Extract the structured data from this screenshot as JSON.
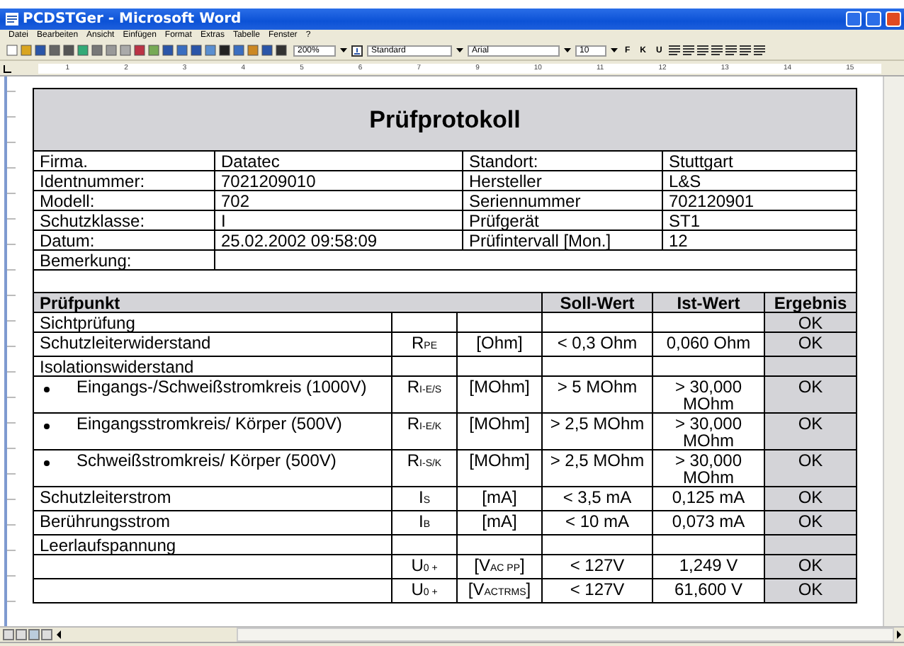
{
  "window": {
    "title": "PCDSTGer - Microsoft Word"
  },
  "menu": [
    "Datei",
    "Bearbeiten",
    "Ansicht",
    "Einfügen",
    "Format",
    "Extras",
    "Tabelle",
    "Fenster",
    "?"
  ],
  "toolbar": {
    "zoom": "200%",
    "style": "Standard",
    "font": "Arial",
    "font_size": "10",
    "format_buttons": [
      "F",
      "K",
      "U"
    ]
  },
  "ruler": {
    "ticks": [
      "1",
      "2",
      "3",
      "4",
      "5",
      "6",
      "7",
      "9",
      "10",
      "11",
      "12",
      "13",
      "14",
      "15"
    ]
  },
  "document": {
    "title": "Prüfprotokoll",
    "info_rows": [
      [
        "Firma.",
        "Datatec",
        "Standort:",
        "Stuttgart"
      ],
      [
        "Identnummer:",
        "7021209010",
        "Hersteller",
        "L&S"
      ],
      [
        "Modell:",
        "702",
        "Seriennummer",
        "702120901"
      ],
      [
        "Schutzklasse:",
        "I",
        "Prüfgerät",
        "ST1"
      ],
      [
        "Datum:",
        "25.02.2002 09:58:09",
        "Prüfintervall [Mon.]",
        "12"
      ]
    ],
    "remark_label": "Bemerkung:",
    "columns": [
      "Prüfpunkt",
      "Soll-Wert",
      "Ist-Wert",
      "Ergebnis"
    ],
    "rows": [
      {
        "kind": "plain",
        "test": "Sichtprüfung",
        "result": "OK"
      },
      {
        "kind": "plain",
        "test": "Schutzleiterwiderstand",
        "symbol": "R$_{PE}$",
        "unit": "[Ohm]",
        "target": "< 0,3 Ohm",
        "actual": "0,060 Ohm",
        "result": "OK"
      },
      {
        "kind": "plain",
        "test": "Isolationswiderstand"
      },
      {
        "kind": "bullet",
        "test": "Eingangs-/Schweißstromkreis (1000V)",
        "symbol": "R$_{I-E/S}$",
        "unit": "[MOhm]",
        "target": "> 5 MOhm",
        "actual": "> 30,000 MOhm",
        "result": "OK"
      },
      {
        "kind": "bullet",
        "test": "Eingangsstromkreis/ Körper (500V)",
        "symbol": "R$_{I-E/K}$",
        "unit": "[MOhm]",
        "target": "> 2,5 MOhm",
        "actual": "> 30,000 MOhm",
        "result": "OK"
      },
      {
        "kind": "bullet",
        "test": "Schweißstromkreis/ Körper (500V)",
        "symbol": "R$_{I-S/K}$",
        "unit": "[MOhm]",
        "target": "> 2,5 MOhm",
        "actual": "> 30,000 MOhm",
        "result": "OK"
      },
      {
        "kind": "plain",
        "test": "Schutzleiterstrom",
        "symbol": "I$_{S}$",
        "unit": "[mA]",
        "target": "< 3,5 mA",
        "actual": "0,125 mA",
        "result": "OK"
      },
      {
        "kind": "plain",
        "test": "Berührungsstrom",
        "symbol": "I$_{B}$",
        "unit": "[mA]",
        "target": "< 10 mA",
        "actual": "0,073 mA",
        "result": "OK"
      },
      {
        "kind": "plain",
        "test": "Leerlaufspannung"
      },
      {
        "kind": "plain",
        "symbol": "U$_{0 +}$",
        "unit": "[V$_{AC PP}$]",
        "target": "< 127V",
        "actual": "1,249 V",
        "result": "OK"
      },
      {
        "kind": "plain",
        "symbol": "U$_{0 +}$",
        "unit": "[V$_{ACTRMS}$]",
        "target": "< 127V",
        "actual": "61,600 V",
        "result": "OK"
      }
    ]
  }
}
